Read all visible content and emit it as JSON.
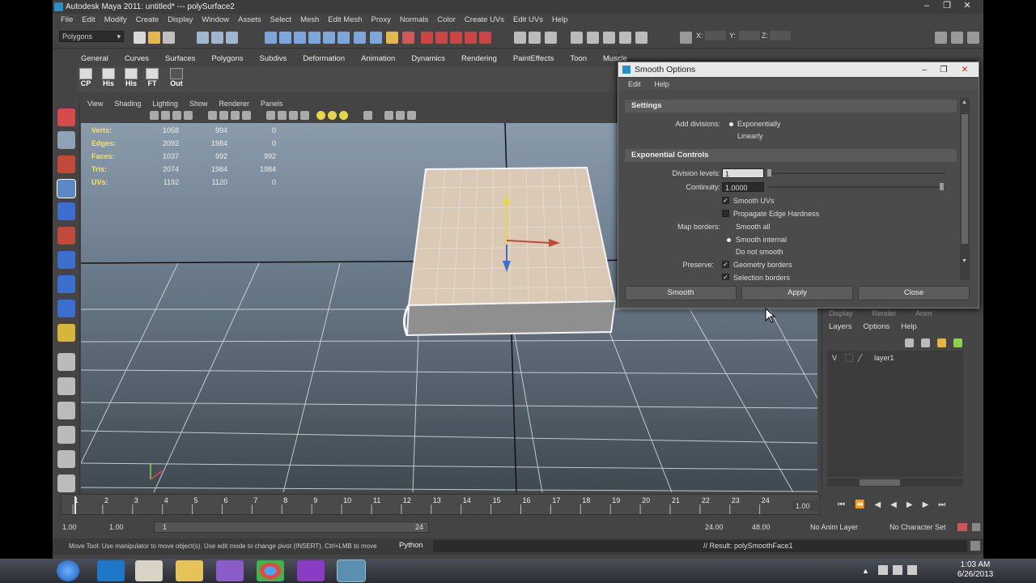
{
  "window": {
    "title": "Autodesk Maya 2011: untitled*   ---   polySurface2"
  },
  "menu": [
    "File",
    "Edit",
    "Modify",
    "Create",
    "Display",
    "Window",
    "Assets",
    "Select",
    "Mesh",
    "Edit Mesh",
    "Proxy",
    "Normals",
    "Color",
    "Create UVs",
    "Edit UVs",
    "Help"
  ],
  "status": {
    "mode": "Polygons",
    "x_label": "X:",
    "y_label": "Y:",
    "z_label": "Z:"
  },
  "shelf_tabs": [
    "General",
    "Curves",
    "Surfaces",
    "Polygons",
    "Subdivs",
    "Deformation",
    "Animation",
    "Dynamics",
    "Rendering",
    "PaintEffects",
    "Toon",
    "Muscle"
  ],
  "shelf_buttons": [
    "CP",
    "His",
    "His",
    "FT",
    "Out"
  ],
  "viewport_menu": [
    "View",
    "Shading",
    "Lighting",
    "Show",
    "Renderer",
    "Panels"
  ],
  "hud": {
    "rows": [
      {
        "label": "Verts:",
        "a": "1058",
        "b": "994",
        "c": "0"
      },
      {
        "label": "Edges:",
        "a": "2092",
        "b": "1984",
        "c": "0"
      },
      {
        "label": "Faces:",
        "a": "1037",
        "b": "992",
        "c": "992"
      },
      {
        "label": "Tris:",
        "a": "2074",
        "b": "1984",
        "c": "1984"
      },
      {
        "label": "UVs:",
        "a": "1192",
        "b": "1120",
        "c": "0"
      }
    ]
  },
  "timeline": {
    "ticks": [
      "1",
      "2",
      "3",
      "4",
      "5",
      "6",
      "7",
      "8",
      "9",
      "10",
      "11",
      "12",
      "13",
      "14",
      "15",
      "16",
      "17",
      "18",
      "19",
      "20",
      "21",
      "22",
      "23",
      "24"
    ],
    "current": "1.00"
  },
  "range": {
    "start": "1.00",
    "start2": "1.00",
    "inner": "1",
    "end_mark": "24",
    "end": "24.00",
    "end2": "48.00",
    "anim_layer": "No Anim Layer",
    "char_set": "No Character Set"
  },
  "cmdline": {
    "help": "Move Tool: Use manipulator to move object(s). Use edit mode to change pivot (INSERT). Ctrl+LMB to move",
    "lang": "Python",
    "result": "// Result: polySmoothFace1"
  },
  "layer_panel": {
    "tabs": [
      "Display",
      "Render",
      "Anim"
    ],
    "menu": [
      "Layers",
      "Options",
      "Help"
    ],
    "layer_vis": "V",
    "layer_name": "layer1"
  },
  "dialog": {
    "title": "Smooth Options",
    "menu": [
      "Edit",
      "Help"
    ],
    "settings_head": "Settings",
    "add_divisions_label": "Add divisions:",
    "opt_exponentially": "Exponentially",
    "opt_linearly": "Linearly",
    "exp_head": "Exponential Controls",
    "division_levels_label": "Division levels:",
    "division_levels_value": "1",
    "continuity_label": "Continuity:",
    "continuity_value": "1.0000",
    "smooth_uvs": "Smooth UVs",
    "propagate": "Propagate Edge Hardness",
    "map_borders_label": "Map borders:",
    "smooth_all": "Smooth all",
    "smooth_internal": "Smooth internal",
    "do_not_smooth": "Do not smooth",
    "preserve_label": "Preserve:",
    "geometry_borders": "Geometry borders",
    "selection_borders": "Selection borders",
    "btn_smooth": "Smooth",
    "btn_apply": "Apply",
    "btn_close": "Close"
  },
  "taskbar": {
    "time": "1:03 AM",
    "date": "6/26/2013"
  }
}
